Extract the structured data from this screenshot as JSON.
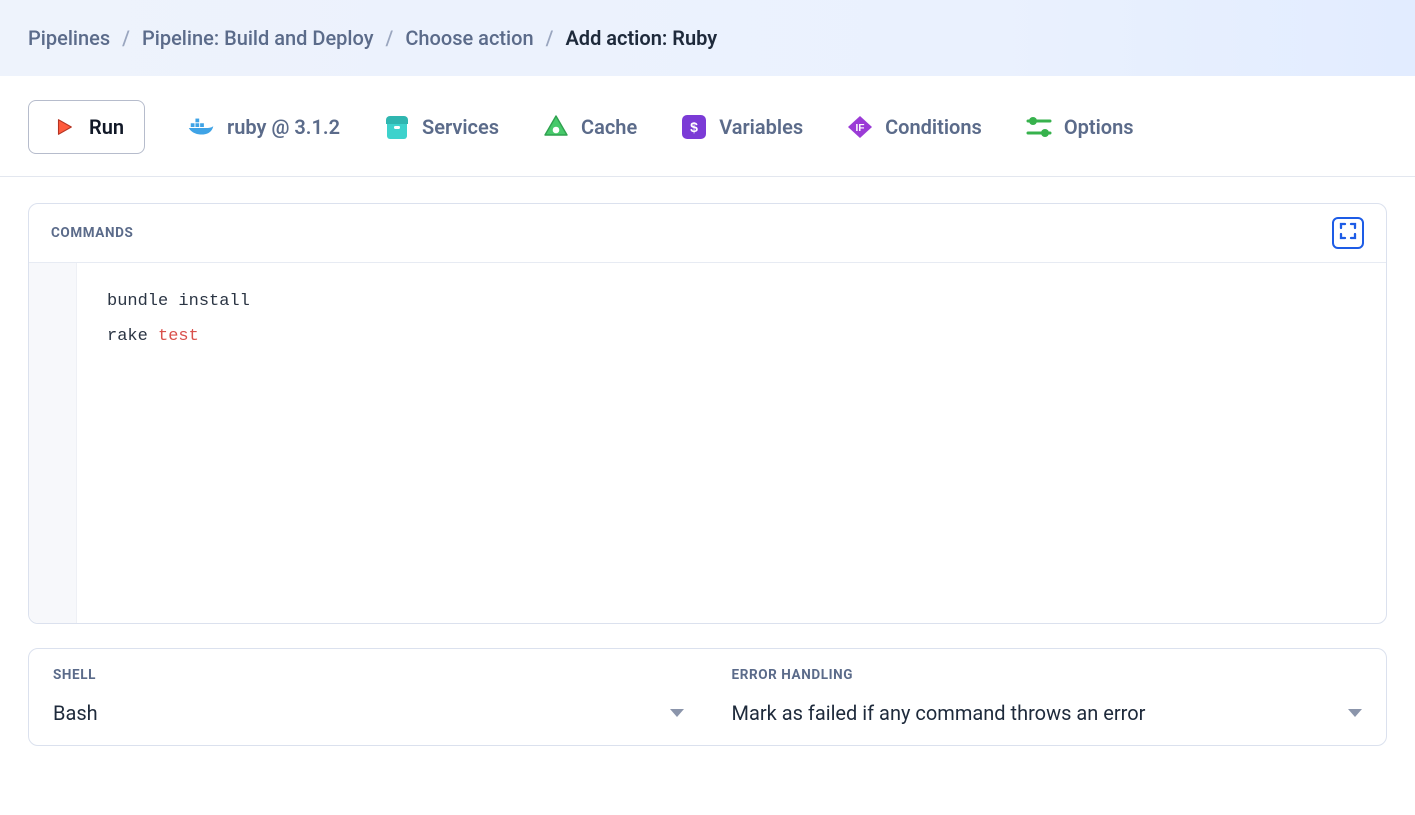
{
  "breadcrumb": {
    "items": [
      {
        "label": "Pipelines"
      },
      {
        "label": "Pipeline: Build and Deploy"
      },
      {
        "label": "Choose action"
      }
    ],
    "current": "Add action: Ruby"
  },
  "tabs": {
    "run": "Run",
    "env": "ruby @ 3.1.2",
    "services": "Services",
    "cache": "Cache",
    "variables": "Variables",
    "conditions": "Conditions",
    "options": "Options"
  },
  "commands": {
    "title": "COMMANDS",
    "line1a": "bundle install",
    "line2a": "rake ",
    "line2b": "test"
  },
  "shell": {
    "title": "SHELL",
    "value": "Bash"
  },
  "error_handling": {
    "title": "ERROR HANDLING",
    "value": "Mark as failed if any command throws an error"
  }
}
